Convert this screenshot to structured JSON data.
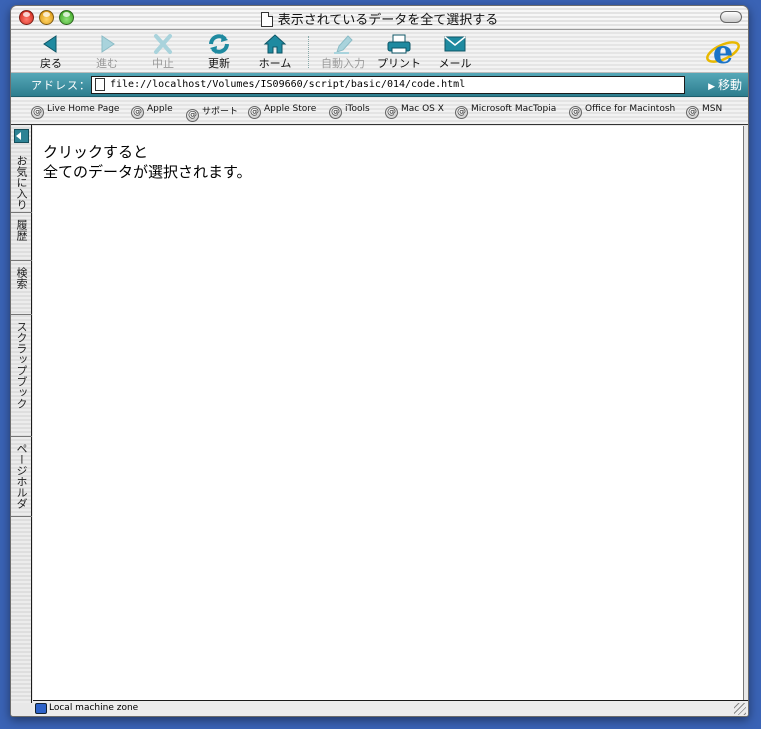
{
  "window": {
    "title": "表示されているデータを全て選択する"
  },
  "toolbar": {
    "back": "戻る",
    "forward": "進む",
    "stop": "中止",
    "refresh": "更新",
    "home": "ホーム",
    "autofill": "自動入力",
    "print": "プリント",
    "mail": "メール"
  },
  "address": {
    "label": "アドレス：",
    "url": "file://localhost/Volumes/IS09660/script/basic/014/code.html",
    "go_label": "移動"
  },
  "favorites": [
    "Live Home Page",
    "Apple",
    "サポート",
    "Apple Store",
    "iTools",
    "Mac OS X",
    "Microsoft MacTopia",
    "Office for Macintosh",
    "MSN"
  ],
  "sidebar": {
    "tabs": [
      "お気に入り",
      "履歴",
      "検索",
      "スクラップブック",
      "ページホルダ"
    ]
  },
  "page": {
    "line1": "クリックすると",
    "line2": "全てのデータが選択されます。"
  },
  "status": {
    "zone": "Local machine zone"
  },
  "colors": {
    "accent": "#2d7d8e",
    "desktop": "#3a63b5"
  },
  "icons": {
    "back": "back-arrow-icon",
    "forward": "forward-arrow-icon",
    "stop": "stop-x-icon",
    "refresh": "refresh-icon",
    "home": "home-icon",
    "autofill": "autofill-pen-icon",
    "print": "printer-icon",
    "mail": "envelope-icon",
    "brand": "ie-logo-icon"
  }
}
